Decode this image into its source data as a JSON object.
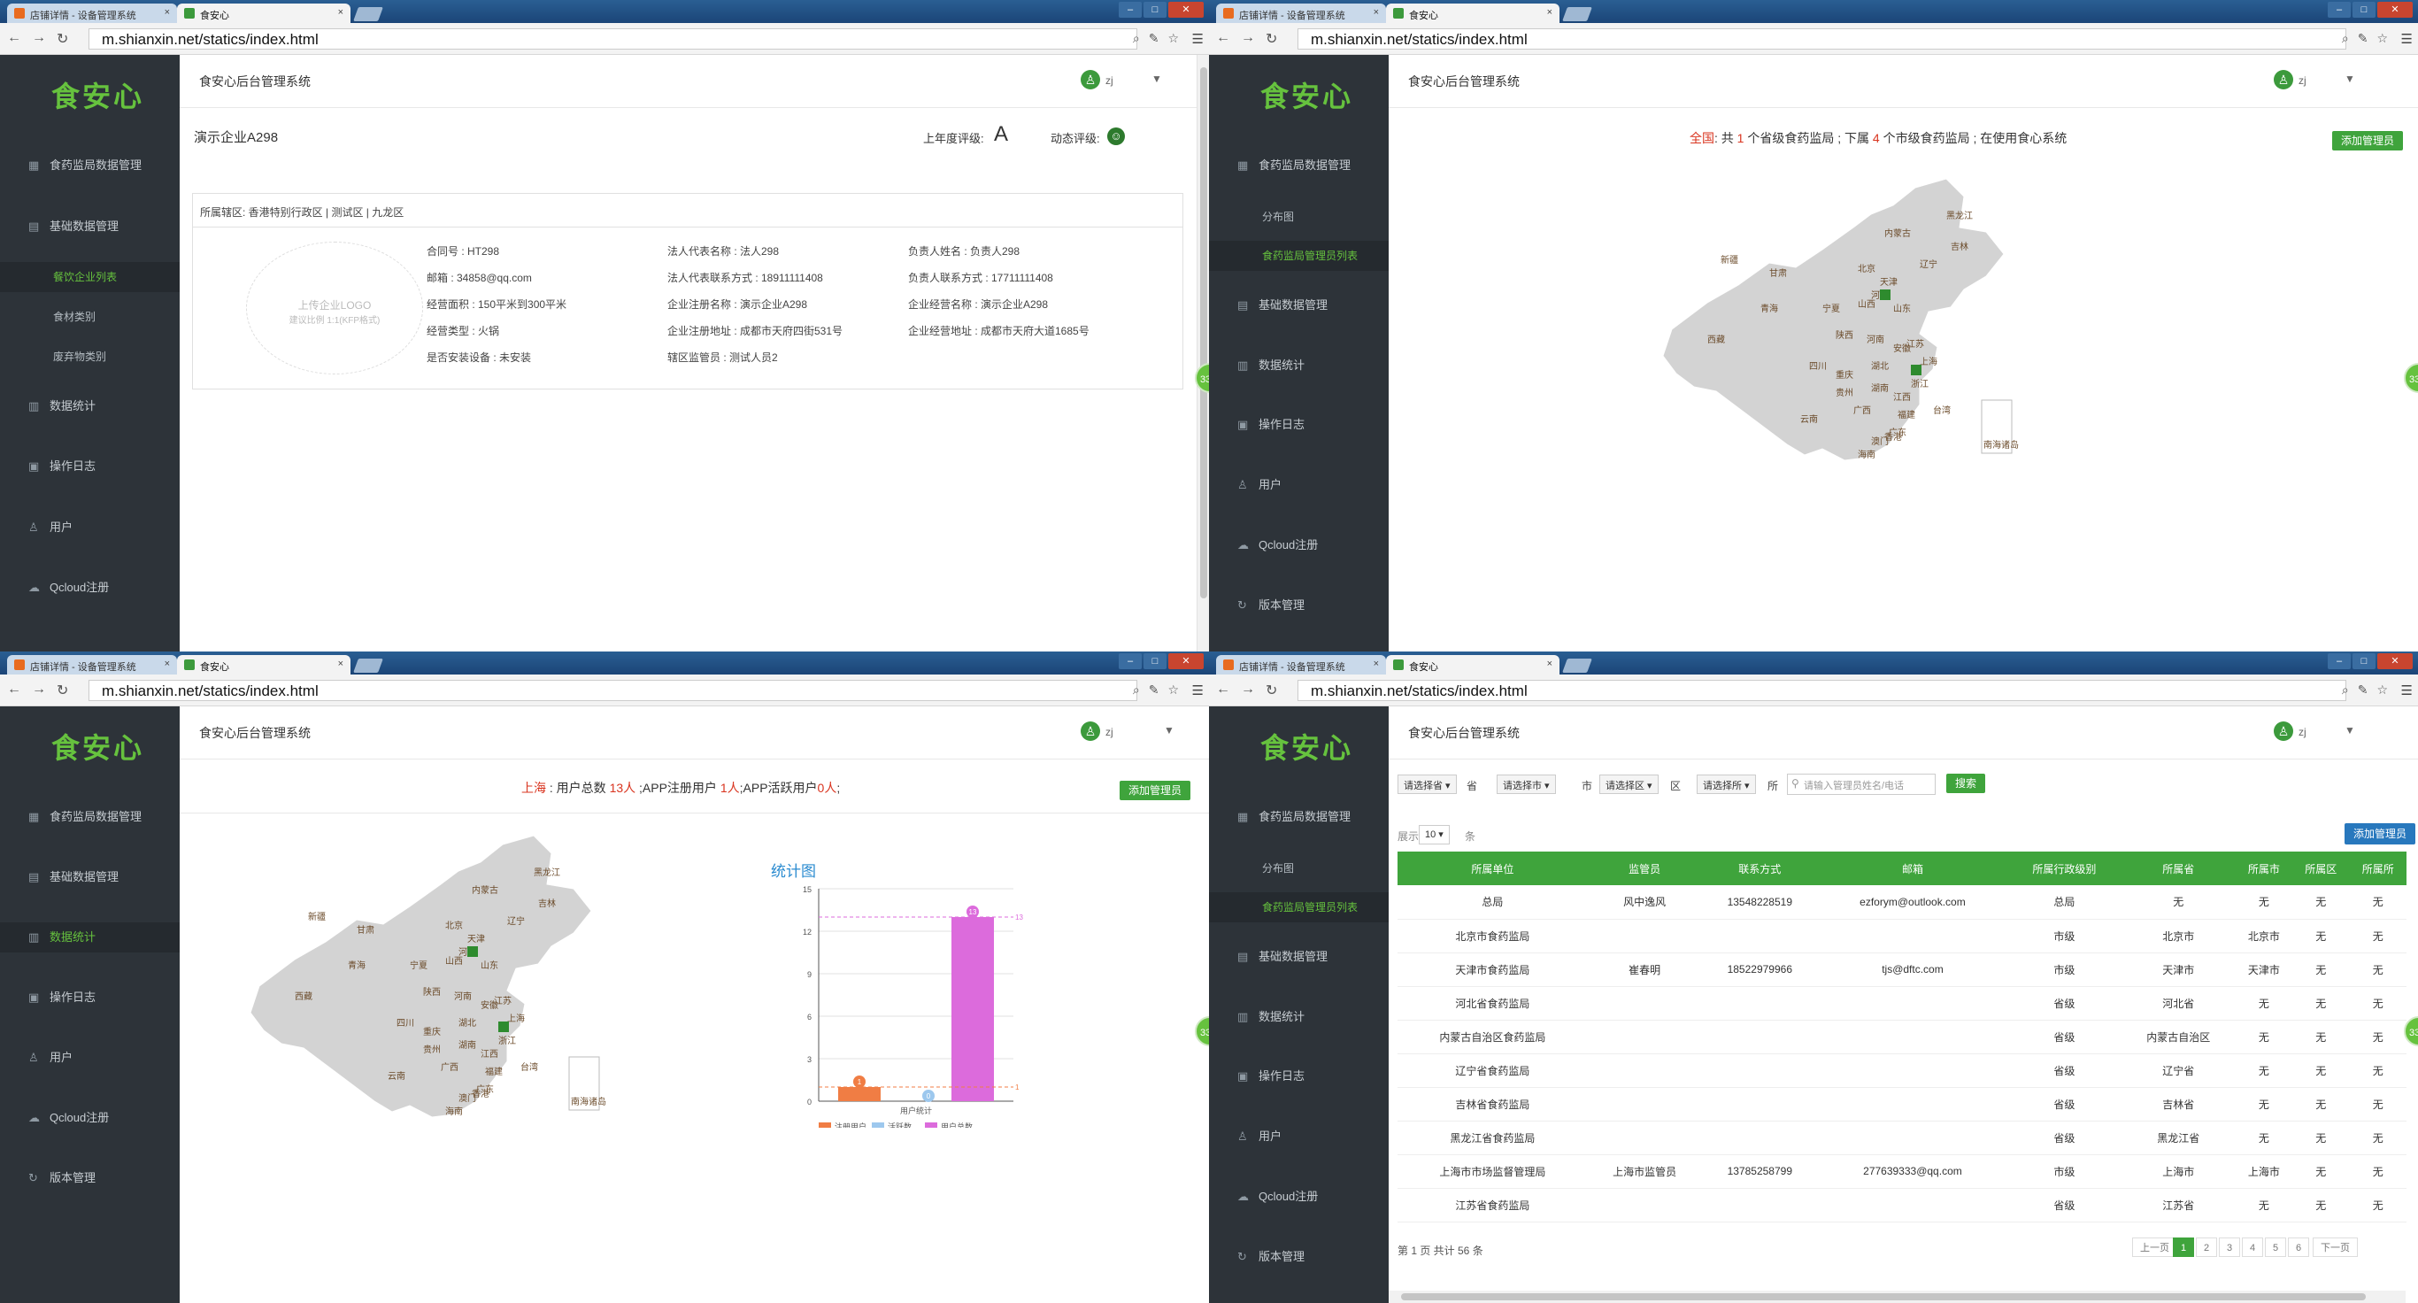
{
  "browser": {
    "tab1_title": "店铺详情 - 设备管理系统",
    "tab2_title": "食安心",
    "close_glyph": "×",
    "url": "m.shianxin.net/statics/index.html"
  },
  "app": {
    "logo": "食安心",
    "system_title": "食安心后台管理系统",
    "user": "zj"
  },
  "side_badge": "33",
  "q1": {
    "sidebar": {
      "food_reg": "食药监局数据管理",
      "base_data": "基础数据管理",
      "sub_catering": "餐饮企业列表",
      "sub_ingredients": "食材类别",
      "sub_waste": "废弃物类别",
      "stats": "数据统计",
      "log": "操作日志",
      "users": "用户",
      "qcloud": "Qcloud注册"
    },
    "enterprise_name": "演示企业A298",
    "rating_year_label": "上年度评级:",
    "rating_year_value": "A",
    "rating_dynamic_label": "动态评级:",
    "rating_dynamic_face": "☺",
    "region": "所属辖区: 香港特别行政区 | 测试区 | 九龙区",
    "logo_placeholder": "上传企业LOGO",
    "logo_hint": "建议比例 1:1(KFP格式)",
    "fields": {
      "contract_no": "合同号 : HT298",
      "email": "邮箱 : 34858@qq.com",
      "area": "经营面积 : 150平米到300平米",
      "type": "经营类型 : 火锅",
      "device": "是否安装设备 : 未安装",
      "legal_name": "法人代表名称 : 法人298",
      "legal_phone": "法人代表联系方式 : 18911111408",
      "reg_name": "企业注册名称 : 演示企业A298",
      "reg_addr": "企业注册地址 : 成都市天府四街531号",
      "supervisor": "辖区监管员 : 测试人员2",
      "owner": "负责人姓名 : 负责人298",
      "owner_phone": "负责人联系方式 : 17711111408",
      "biz_name": "企业经营名称 : 演示企业A298",
      "biz_addr": "企业经营地址 : 成都市天府大道1685号"
    }
  },
  "q2": {
    "sidebar": {
      "food_reg": "食药监局数据管理",
      "sub_dist": "分布图",
      "sub_admin": "食药监局管理员列表",
      "base_data": "基础数据管理",
      "stats": "数据统计",
      "log": "操作日志",
      "users": "用户",
      "qcloud": "Qcloud注册",
      "version": "版本管理"
    },
    "summary": {
      "prefix": "全国",
      "text1": ": 共 ",
      "n1": "1",
      "text2": " 个省级食药监局 ; 下属 ",
      "n2": "4",
      "text3": " 个市级食药监局 ; 在使用食心系统"
    },
    "add_admin": "添加管理员",
    "map_inset": "南海诸岛"
  },
  "q3": {
    "sidebar": {
      "food_reg": "食药监局数据管理",
      "base_data": "基础数据管理",
      "stats": "数据统计",
      "log": "操作日志",
      "users": "用户",
      "qcloud": "Qcloud注册",
      "version": "版本管理"
    },
    "summary": {
      "city": "上海",
      "t1": " : 用户总数 ",
      "n1": "13人",
      "t2": " ;APP注册用户 ",
      "n2": "1人",
      "t3": ";APP活跃用户",
      "n3": "0人",
      "t4": ";"
    },
    "add_admin": "添加管理员",
    "chart_title": "统计图",
    "map_inset": "南海诸岛",
    "chart_data": {
      "type": "bar",
      "categories": [
        "用户统计"
      ],
      "series": [
        {
          "name": "注册用户",
          "values": [
            1
          ],
          "color": "#f07d44"
        },
        {
          "name": "活跃数",
          "values": [
            0
          ],
          "color": "#9dc8ee"
        },
        {
          "name": "用户总数",
          "values": [
            13
          ],
          "color": "#dc6bdc"
        }
      ],
      "xlabel": "用户统计",
      "ylim": [
        0,
        15
      ],
      "yticks": [
        "0",
        "3",
        "6",
        "9",
        "12",
        "15"
      ],
      "markline_labels": [
        "13",
        "1"
      ],
      "grid": true,
      "legend": "bottom"
    }
  },
  "q4": {
    "sidebar": {
      "food_reg": "食药监局数据管理",
      "sub_dist": "分布图",
      "sub_admin": "食药监局管理员列表",
      "base_data": "基础数据管理",
      "stats": "数据统计",
      "log": "操作日志",
      "users": "用户",
      "qcloud": "Qcloud注册",
      "version": "版本管理"
    },
    "filters": {
      "province": "请选择省",
      "province_unit": "省",
      "city": "请选择市",
      "city_unit": "市",
      "district": "请选择区",
      "district_unit": "区",
      "office": "请选择所",
      "office_unit": "所",
      "search_placeholder": "请输入管理员姓名/电话",
      "search_btn": "搜索"
    },
    "show_label": "展示",
    "show_value": "10",
    "show_unit": "条",
    "add_admin": "添加管理员",
    "columns": [
      "所属单位",
      "监管员",
      "联系方式",
      "邮箱",
      "所属行政级别",
      "所属省",
      "所属市",
      "所属区",
      "所属所"
    ],
    "rows": [
      [
        "总局",
        "风中逸风",
        "13548228519",
        "ezforym@outlook.com",
        "总局",
        "无",
        "无",
        "无",
        "无"
      ],
      [
        "北京市食药监局",
        "",
        "",
        "",
        "市级",
        "北京市",
        "北京市",
        "无",
        "无"
      ],
      [
        "天津市食药监局",
        "崔春明",
        "18522979966",
        "tjs@dftc.com",
        "市级",
        "天津市",
        "天津市",
        "无",
        "无"
      ],
      [
        "河北省食药监局",
        "",
        "",
        "",
        "省级",
        "河北省",
        "无",
        "无",
        "无"
      ],
      [
        "内蒙古自治区食药监局",
        "",
        "",
        "",
        "省级",
        "内蒙古自治区",
        "无",
        "无",
        "无"
      ],
      [
        "辽宁省食药监局",
        "",
        "",
        "",
        "省级",
        "辽宁省",
        "无",
        "无",
        "无"
      ],
      [
        "吉林省食药监局",
        "",
        "",
        "",
        "省级",
        "吉林省",
        "无",
        "无",
        "无"
      ],
      [
        "黑龙江省食药监局",
        "",
        "",
        "",
        "省级",
        "黑龙江省",
        "无",
        "无",
        "无"
      ],
      [
        "上海市市场监督管理局",
        "上海市监管员",
        "13785258799",
        "277639333@qq.com",
        "市级",
        "上海市",
        "上海市",
        "无",
        "无"
      ],
      [
        "江苏省食药监局",
        "",
        "",
        "",
        "省级",
        "江苏省",
        "无",
        "无",
        "无"
      ]
    ],
    "pager_info": "第 1 页 共计 56 条",
    "prev": "上一页",
    "pages": [
      "1",
      "2",
      "3",
      "4",
      "5",
      "6"
    ],
    "next": "下一页"
  },
  "map_labels": [
    "黑龙江",
    "吉林",
    "辽宁",
    "内蒙古",
    "新疆",
    "甘肃",
    "青海",
    "西藏",
    "宁夏",
    "山西",
    "河北",
    "天津",
    "北京",
    "山东",
    "河南",
    "陕西",
    "四川",
    "重庆",
    "湖北",
    "安徽",
    "江苏",
    "浙江",
    "上海",
    "湖南",
    "江西",
    "福建",
    "贵州",
    "云南",
    "广西",
    "广东",
    "台湾",
    "海南",
    "香港",
    "澳门"
  ]
}
